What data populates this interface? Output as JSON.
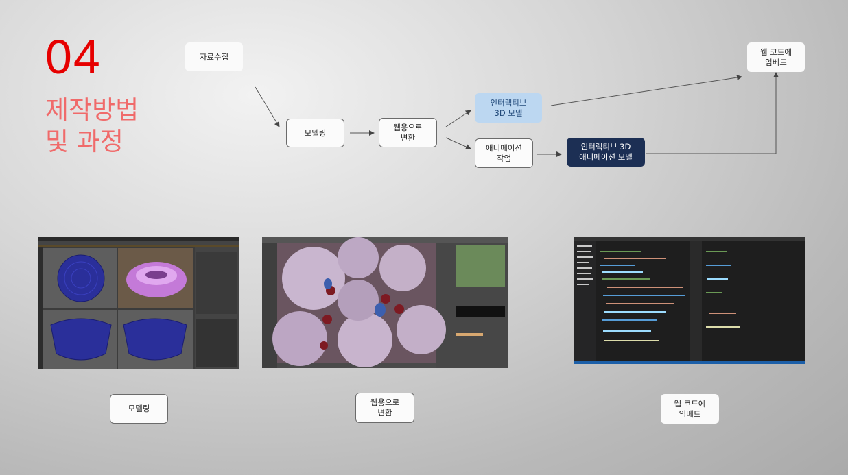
{
  "section": {
    "number": "04",
    "title": "제작방법\n및 과정"
  },
  "flow": {
    "nodes": {
      "collect": "자료수집",
      "modeling": "모델링",
      "convert": "웹용으로\n변환",
      "interactive": "인터랙티브\n3D 모델",
      "animation_work": "애니메이션\n작업",
      "interactive_anim": "인터랙티브 3D\n애니메이션 모델",
      "embed": "웹 코드에\n임베드"
    }
  },
  "captions": {
    "modeling": "모델링",
    "convert": "웹용으로\n변환",
    "embed": "웹 코드에\n임베드"
  },
  "colors": {
    "accent_red": "#e60000",
    "title_salmon": "#f06a6a",
    "light_blue": "#bcd7f1",
    "navy": "#1c2f54"
  }
}
